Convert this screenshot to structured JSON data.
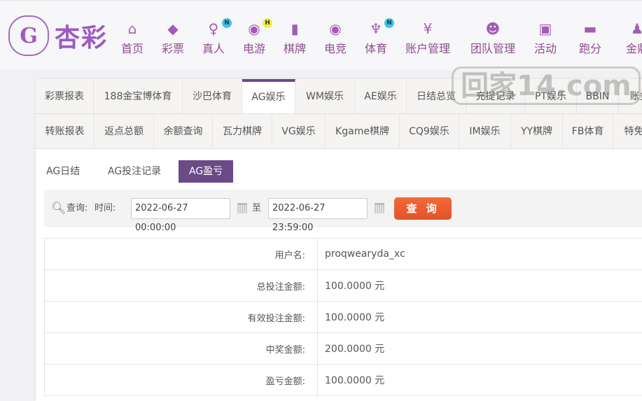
{
  "logo": {
    "text": "杏彩",
    "mark": "G"
  },
  "nav": [
    {
      "label": "首页",
      "icon": "home-icon"
    },
    {
      "label": "彩票",
      "icon": "ticket-icon"
    },
    {
      "label": "真人",
      "icon": "dealer-icon",
      "badge": "N"
    },
    {
      "label": "电游",
      "icon": "gamepad-icon",
      "badge": "H"
    },
    {
      "label": "棋牌",
      "icon": "cards-icon"
    },
    {
      "label": "电竞",
      "icon": "gamepad-icon"
    },
    {
      "label": "体育",
      "icon": "trophy-icon",
      "badge": "N"
    },
    {
      "label": "账户管理",
      "icon": "yen-coin-icon"
    },
    {
      "label": "团队管理",
      "icon": "team-icon"
    },
    {
      "label": "活动",
      "icon": "gift-icon"
    },
    {
      "label": "跑分",
      "icon": "rhino-icon"
    },
    {
      "label": "金鼎",
      "icon": "person-icon"
    }
  ],
  "tabs_row1": [
    "彩票报表",
    "188金宝博体育",
    "沙巴体育",
    "AG娱乐",
    "WM娱乐",
    "AE娱乐",
    "日结总览",
    "充提记录",
    "PT娱乐",
    "BBIN",
    "账务"
  ],
  "tabs_row2": [
    "转账报表",
    "返点总额",
    "余额查询",
    "瓦力棋牌",
    "VG娱乐",
    "Kgame棋牌",
    "CQ9娱乐",
    "IM娱乐",
    "YY棋牌",
    "FB体育",
    "特免"
  ],
  "active_tab": "AG娱乐",
  "subtabs": [
    "AG日结",
    "AG投注记录",
    "AG盈亏"
  ],
  "active_subtab": "AG盈亏",
  "query": {
    "label": "查询:",
    "time_label": "时间:",
    "start": "2022-06-27 00:00:00",
    "to": "至",
    "end": "2022-06-27 23:59:00",
    "button": "查 询"
  },
  "rows": [
    {
      "label": "用户名:",
      "value": "proqwearyda_xc"
    },
    {
      "label": "总投注金额:",
      "value": "100.0000 元"
    },
    {
      "label": "有效投注金额:",
      "value": "100.0000 元"
    },
    {
      "label": "中奖金额:",
      "value": "200.0000 元"
    },
    {
      "label": "盈亏金额:",
      "value": "100.0000 元"
    }
  ],
  "watermark": "回家14.com",
  "colors": {
    "brand": "#6b4a8a",
    "nav_text": "#8c4f8e",
    "icon": "#a45bb6",
    "button": "#e85a2e"
  }
}
